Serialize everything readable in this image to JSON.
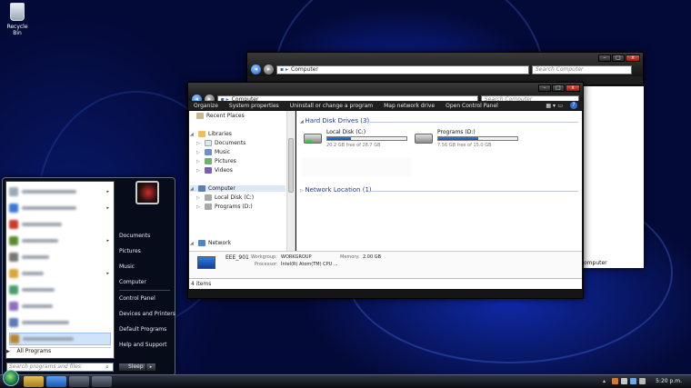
{
  "desktop": {
    "recycle_bin": "Recycle Bin"
  },
  "back_window": {
    "breadcrumb": "Computer",
    "search_placeholder": "Search Computer",
    "peek_text": "omputer"
  },
  "explorer": {
    "breadcrumb": "Computer",
    "search_placeholder": "Search Computer",
    "toolbar": [
      "Organize",
      "System properties",
      "Uninstall or change a program",
      "Map network drive",
      "Open Control Panel"
    ],
    "nav": {
      "recent": "Recent Places",
      "libraries": "Libraries",
      "documents": "Documents",
      "music": "Music",
      "pictures": "Pictures",
      "videos": "Videos",
      "computer": "Computer",
      "local_disk": "Local Disk (C:)",
      "programs_drive": "Programs (D:)",
      "network": "Network"
    },
    "hdd_header": "Hard Disk Drives (3)",
    "drives": [
      {
        "name": "Local Disk (C:)",
        "free": "20.2 GB free of 28.7 GB",
        "used_fraction": 0.3
      },
      {
        "name": "Programs (D:)",
        "free": "7.56 GB free of 15.0 GB",
        "used_fraction": 0.5
      }
    ],
    "net_header": "Network Location (1)",
    "details": {
      "name": "EEE_901",
      "workgroup_label": "Workgroup:",
      "workgroup": "WORKGROUP",
      "memory_label": "Memory:",
      "memory": "2.00 GB",
      "processor_label": "Processor:",
      "processor": "Intel(R) Atom(TM) CPU ..."
    },
    "status": "4 items"
  },
  "start_menu": {
    "right_items": [
      "Documents",
      "Pictures",
      "Music",
      "Computer",
      "Control Panel",
      "Devices and Printers",
      "Default Programs",
      "Help and Support"
    ],
    "all_programs": "All Programs",
    "search_placeholder": "Search programs and files",
    "sleep": "Sleep"
  },
  "taskbar": {
    "clock": "5:20 p.m."
  },
  "colors": {
    "accent": "#1757b0",
    "desktop": "#040a38"
  }
}
